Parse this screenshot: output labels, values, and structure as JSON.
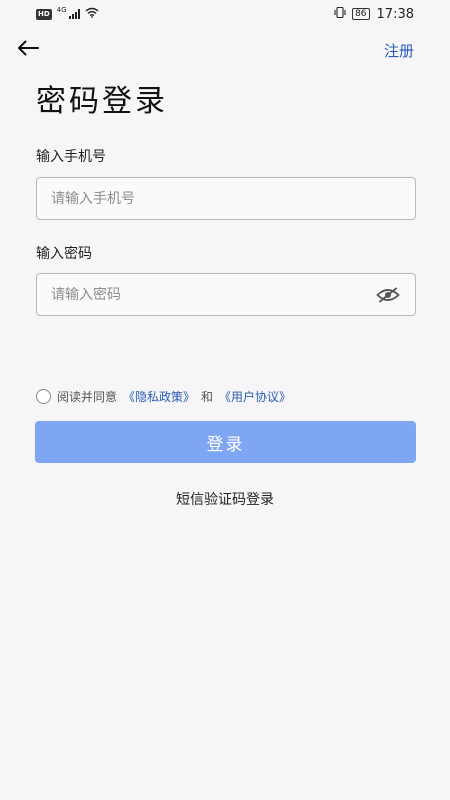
{
  "status_bar": {
    "hd_badge": "HD",
    "network": "4G",
    "battery": "86",
    "time": "17:38"
  },
  "nav": {
    "back_icon": "arrow-left-icon",
    "register_label": "注册"
  },
  "page_title": "密码登录",
  "phone": {
    "label": "输入手机号",
    "placeholder": "请输入手机号",
    "value": ""
  },
  "password": {
    "label": "输入密码",
    "placeholder": "请输入密码",
    "value": "",
    "toggle_icon": "eye-off-icon"
  },
  "agreement": {
    "prefix": "阅读并同意",
    "privacy_link": "《隐私政策》",
    "and": "和",
    "user_link": "《用户协议》",
    "checked": false
  },
  "login_button_label": "登录",
  "sms_login_label": "短信验证码登录",
  "colors": {
    "accent": "#2a5bb5",
    "button": "#7fa6f3",
    "background": "#f6f6f8"
  }
}
